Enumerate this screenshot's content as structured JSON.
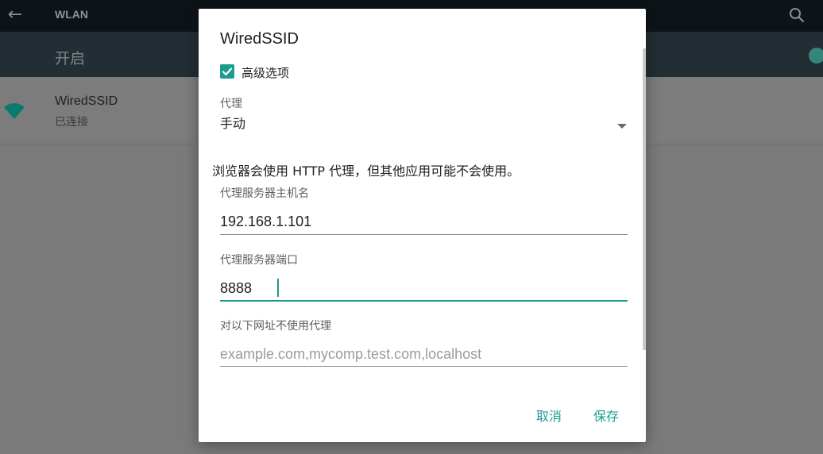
{
  "appbar": {
    "title": "WLAN",
    "back_icon": "arrow-left-icon",
    "search_icon": "search-icon"
  },
  "switchbar": {
    "label": "开启"
  },
  "network": {
    "name": "WiredSSID",
    "status": "已连接",
    "icon": "wifi-icon"
  },
  "dialog": {
    "title": "WiredSSID",
    "advanced_label": "高级选项",
    "advanced_checked": true,
    "proxy": {
      "label": "代理",
      "value": "手动"
    },
    "info": "浏览器会使用 HTTP 代理，但其他应用可能不会使用。",
    "hostname": {
      "label": "代理服务器主机名",
      "value": "192.168.1.101"
    },
    "port": {
      "label": "代理服务器端口",
      "value": "8888"
    },
    "bypass": {
      "label": "对以下网址不使用代理",
      "placeholder": "example.com,mycomp.test.com,localhost"
    },
    "cancel_label": "取消",
    "save_label": "保存"
  },
  "colors": {
    "accent": "#1c9c8f",
    "topbar": "#0d1418",
    "switchbar": "#222e34"
  }
}
